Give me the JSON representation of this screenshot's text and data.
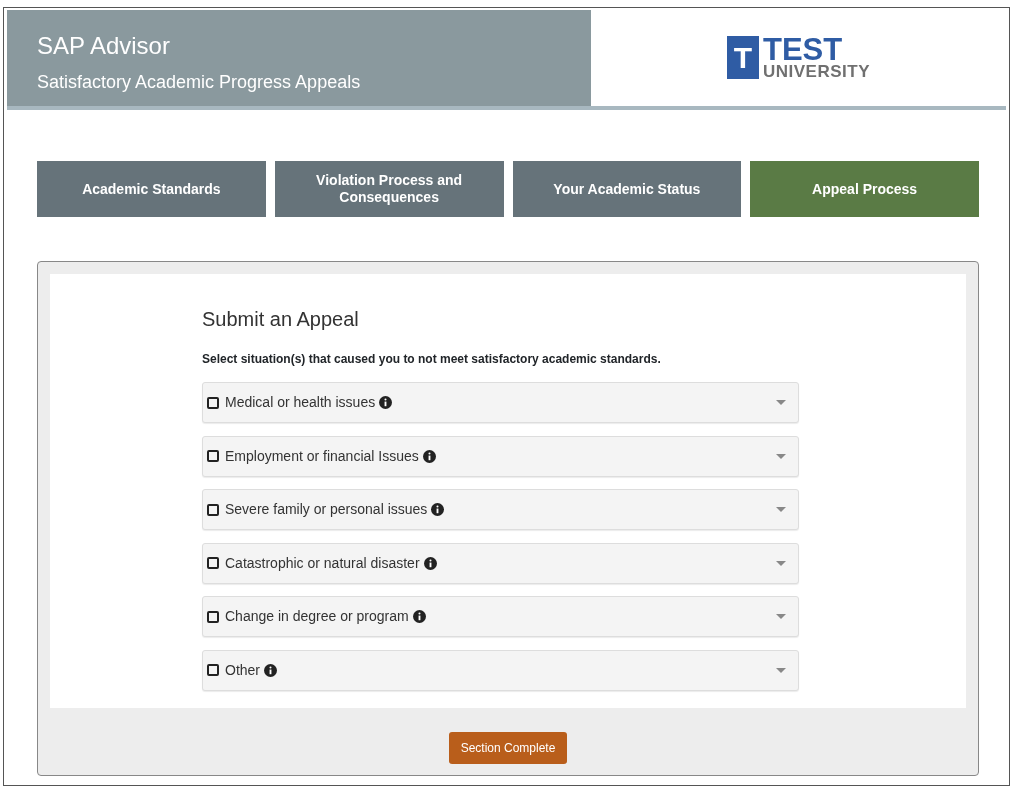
{
  "header": {
    "title": "SAP Advisor",
    "subtitle": "Satisfactory Academic Progress Appeals",
    "logo": {
      "mark": "T",
      "name": "TEST",
      "sub": "UNIVERSITY"
    }
  },
  "tabs": [
    {
      "label": "Academic Standards",
      "selected": false
    },
    {
      "label": "Violation Process and Consequences",
      "selected": false
    },
    {
      "label": "Your Academic Status",
      "selected": false
    },
    {
      "label": "Appeal Process",
      "selected": true
    }
  ],
  "section": {
    "title": "Submit an Appeal",
    "instruction": "Select situation(s) that caused you to not meet satisfactory academic standards.",
    "situations": [
      {
        "label": "Medical or health issues",
        "checked": false,
        "expanded": false
      },
      {
        "label": "Employment or financial Issues",
        "checked": false,
        "expanded": false
      },
      {
        "label": "Severe family or personal issues",
        "checked": false,
        "expanded": false
      },
      {
        "label": "Catastrophic or natural disaster",
        "checked": false,
        "expanded": false
      },
      {
        "label": "Change in degree or program",
        "checked": false,
        "expanded": false
      },
      {
        "label": "Other",
        "checked": false,
        "expanded": false
      }
    ]
  },
  "complete_button": "Section Complete"
}
